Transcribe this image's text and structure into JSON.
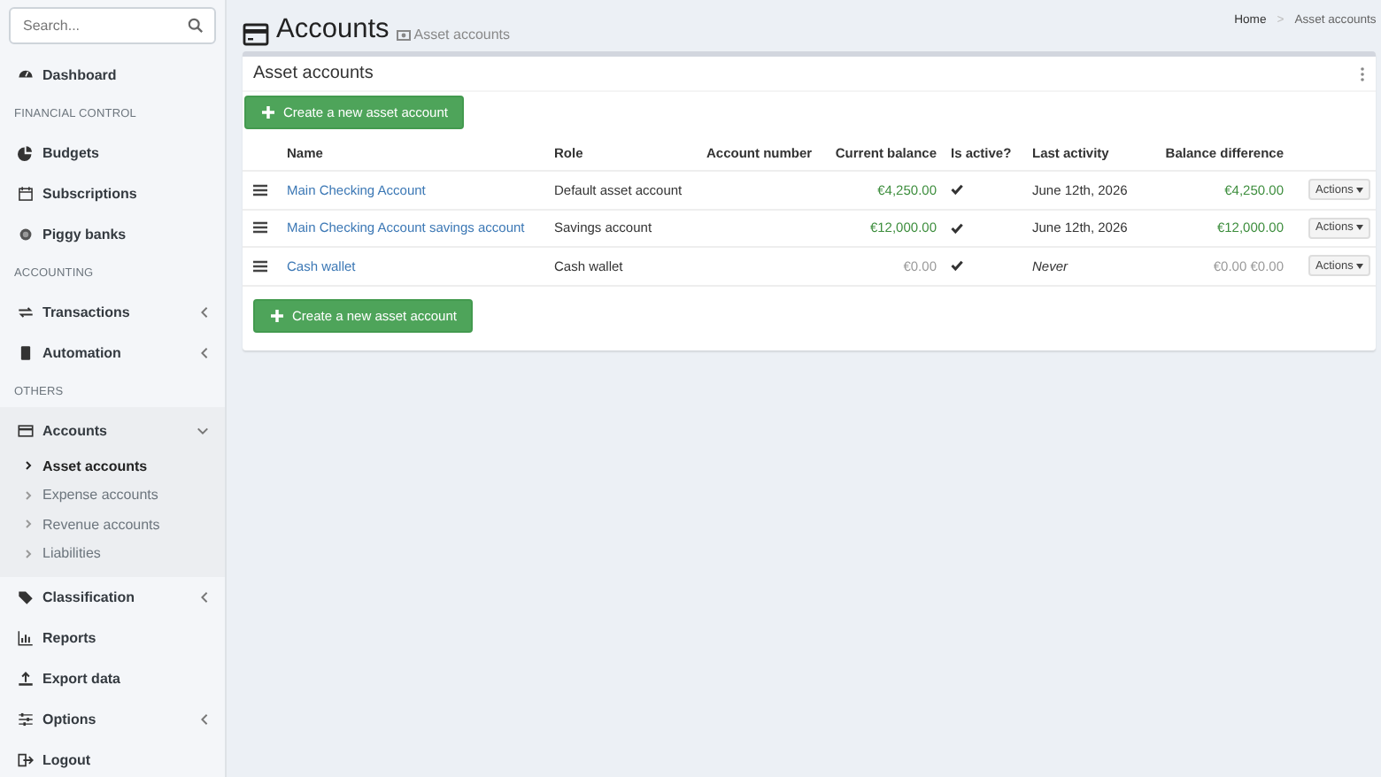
{
  "sidebar": {
    "search": {
      "placeholder": "Search..."
    },
    "items": [
      {
        "kind": "link",
        "label": "Dashboard"
      },
      {
        "kind": "header",
        "label": "FINANCIAL CONTROL"
      },
      {
        "kind": "link",
        "label": "Budgets"
      },
      {
        "kind": "link",
        "label": "Subscriptions"
      },
      {
        "kind": "link",
        "label": "Piggy banks"
      },
      {
        "kind": "header",
        "label": "ACCOUNTING"
      },
      {
        "kind": "link",
        "label": "Transactions",
        "expanded": false
      },
      {
        "kind": "link",
        "label": "Automation",
        "expanded": false
      },
      {
        "kind": "header",
        "label": "OTHERS"
      },
      {
        "kind": "link",
        "label": "Accounts",
        "expanded": true,
        "children": [
          {
            "label": "Asset accounts",
            "selected": true
          },
          {
            "label": "Expense accounts",
            "selected": false
          },
          {
            "label": "Revenue accounts",
            "selected": false
          },
          {
            "label": "Liabilities",
            "selected": false
          }
        ]
      },
      {
        "kind": "link",
        "label": "Classification",
        "expanded": false
      },
      {
        "kind": "link",
        "label": "Reports"
      },
      {
        "kind": "link",
        "label": "Export data"
      },
      {
        "kind": "link",
        "label": "Options",
        "expanded": false
      },
      {
        "kind": "link",
        "label": "Logout"
      }
    ]
  },
  "header": {
    "title": "Accounts",
    "subtitle": "Asset accounts",
    "breadcrumb": [
      "Home",
      "Asset accounts"
    ],
    "breadcrumb_separator": ">"
  },
  "box": {
    "title": "Asset accounts",
    "create_buttons": [
      "Create a new asset account",
      "Create a new asset account"
    ],
    "table": {
      "columns": [
        "Name",
        "Role",
        "Account number",
        "Current balance",
        "Is active?",
        "Last activity",
        "Balance difference"
      ],
      "rows": [
        {
          "name": "Main Checking Account",
          "role": "Default asset account",
          "current_balance": {
            "text": "€4,250.00",
            "positive": true
          },
          "active": true,
          "last_activity": "June 12th, 2026",
          "no_activity": false,
          "balance_difference": {
            "text": "€4,250.00",
            "positive": true
          },
          "action": "Actions"
        },
        {
          "name": "Main Checking Account savings account",
          "role": "Savings account",
          "current_balance": {
            "text": "€12,000.00",
            "positive": true
          },
          "active": true,
          "last_activity": "June 12th, 2026",
          "no_activity": false,
          "balance_difference": {
            "text": "€12,000.00",
            "positive": true
          },
          "action": "Actions"
        },
        {
          "name": "Cash wallet",
          "role": "Cash wallet",
          "current_balance": {
            "text": "€0.00",
            "positive": false
          },
          "active": true,
          "last_activity": "Never",
          "no_activity": true,
          "balance_difference": {
            "text": "€0.00 €0.00",
            "positive": false
          },
          "action": "Actions"
        }
      ]
    }
  }
}
